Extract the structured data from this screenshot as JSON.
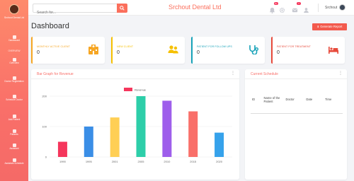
{
  "brand": {
    "name": "Srchout Dental Ltd"
  },
  "sidebar": {
    "items": [
      {
        "label": "Dashboard"
      },
      {
        "label": "Overview"
      },
      {
        "label": "Doctor Registration"
      },
      {
        "label": "Schedule Doctor"
      },
      {
        "label": "Add Patient"
      },
      {
        "label": "Patients"
      },
      {
        "label": "Assistant"
      },
      {
        "label": "Assistant Schedule"
      }
    ],
    "section_label": "OVERVIEW"
  },
  "header": {
    "search_placeholder": "Search for...",
    "title": "Srchout Dental Ltd",
    "notification_count": "3+",
    "message_count": "7",
    "user_name": "Srchout"
  },
  "page": {
    "title": "Dashboard",
    "generate_report_label": "Generate Report"
  },
  "cards": [
    {
      "label": "MONTHLY ACTIVE CLIENT",
      "value": "0",
      "color": "#f6a623",
      "icon": "hospital-icon"
    },
    {
      "label": "NEW CLIENT",
      "value": "0",
      "color": "#f6c000",
      "icon": "users-icon"
    },
    {
      "label": "PATIENT FOR FOLLOW UPS",
      "value": "0",
      "color": "#17a2b8",
      "icon": "stethoscope-icon"
    },
    {
      "label": "PATIENT FOR TREATMENT",
      "value": "0",
      "color": "#e74a3b",
      "icon": "bed-icon"
    }
  ],
  "revenue_panel": {
    "title": "Bar Graph for Revenue"
  },
  "schedule_panel": {
    "title": "Current Schedule",
    "columns": [
      "ID",
      "Name of the Patient",
      "Doctor",
      "Date",
      "Time"
    ]
  },
  "chart_data": {
    "type": "bar",
    "categories": [
      "1990",
      "1995",
      "2001",
      "2005",
      "2010",
      "2015",
      "2020"
    ],
    "series": [
      {
        "name": "Revenue",
        "values": [
          50,
          100,
          130,
          200,
          185,
          150,
          80
        ]
      }
    ],
    "colors": [
      "#f5365c",
      "#3a8ee6",
      "#ffcf55",
      "#2dcea9",
      "#9e5eeb",
      "#f96f69",
      "#36a2eb"
    ],
    "ylim": [
      0,
      200
    ],
    "yticks": [
      0,
      100,
      200
    ],
    "legend_position": "top"
  }
}
